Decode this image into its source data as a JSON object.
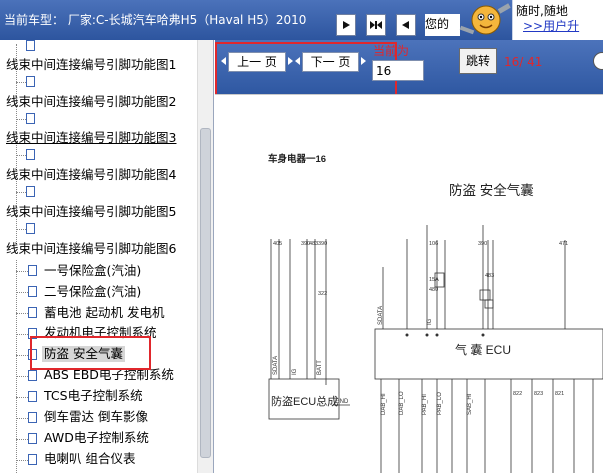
{
  "header": {
    "car_model": "当前车型： 厂家:C-长城汽车哈弗H5（Haval H5）2010",
    "message_text": "您的",
    "promo_line1": "随时,随地",
    "promo_line2": ">>用户升"
  },
  "tree": {
    "items": [
      {
        "label": "线束中间连接编号引脚功能图1"
      },
      {
        "label": "线束中间连接编号引脚功能图2"
      },
      {
        "label": "线束中间连接编号引脚功能图3"
      },
      {
        "label": "线束中间连接编号引脚功能图4"
      },
      {
        "label": "线束中间连接编号引脚功能图5"
      },
      {
        "label": "线束中间连接编号引脚功能图6"
      }
    ],
    "children": [
      {
        "label": "一号保险盒(汽油)"
      },
      {
        "label": "二号保险盒(汽油)"
      },
      {
        "label": "蓄电池 起动机 发电机"
      },
      {
        "label": "发动机电子控制系统"
      },
      {
        "label": "防盗 安全气囊",
        "selected": true
      },
      {
        "label": "ABS EBD电子控制系统"
      },
      {
        "label": "TCS电子控制系统"
      },
      {
        "label": "倒车雷达 倒车影像"
      },
      {
        "label": "AWD电子控制系统"
      },
      {
        "label": "电喇叭 组合仪表"
      }
    ]
  },
  "viewer": {
    "prev_label": "上一 页",
    "next_label": "下一 页",
    "current_label": "当前为",
    "page_value": "16",
    "jump_label": "跳转",
    "page_count": "16/ 41"
  },
  "diagram": {
    "section_title": "车身电器一16",
    "main_title": "防盗 安全气囊",
    "ecu_label": "气 囊 ECU",
    "antitheft_label": "防盗ECU总成",
    "pin_labels": [
      "SDATA",
      "IG",
      "BATT",
      "GND",
      "SDATA",
      "IG",
      "DAB_HI",
      "DAB_LO",
      "PAB_HI",
      "PAB_LO",
      "SAB_HI"
    ],
    "wire_numbers": [
      "405",
      "390",
      "483",
      "390",
      "322",
      "106",
      "390",
      "483",
      "471",
      "822",
      "823",
      "821",
      "15A",
      "480"
    ]
  },
  "colors": {
    "header_bg": "#2d559f",
    "highlight_red": "#e0272c",
    "link_blue": "#2239c4"
  }
}
